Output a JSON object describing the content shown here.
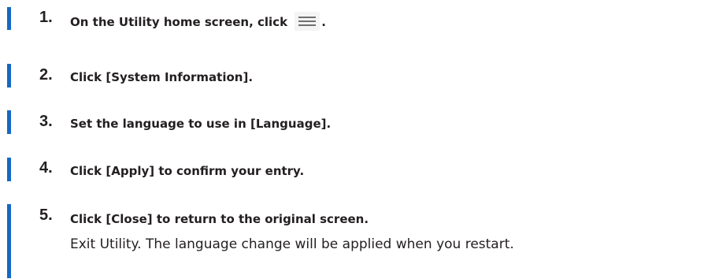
{
  "steps": [
    {
      "number": "1.",
      "before_icon": "On the Utility home screen, click ",
      "icon": "hamburger-menu-icon",
      "after_icon": "."
    },
    {
      "number": "2.",
      "text": "Click [System Information]."
    },
    {
      "number": "3.",
      "text": "Set the language to use in [Language]."
    },
    {
      "number": "4.",
      "text": "Click [Apply] to confirm your entry."
    },
    {
      "number": "5.",
      "text": "Click [Close] to return to the original screen.",
      "note": "Exit Utility. The language change will be applied when you restart."
    }
  ],
  "colors": {
    "step_bar": "#1568c4",
    "text": "#231f20",
    "icon_background": "#f4f4f4",
    "icon_lines": "#707070"
  }
}
